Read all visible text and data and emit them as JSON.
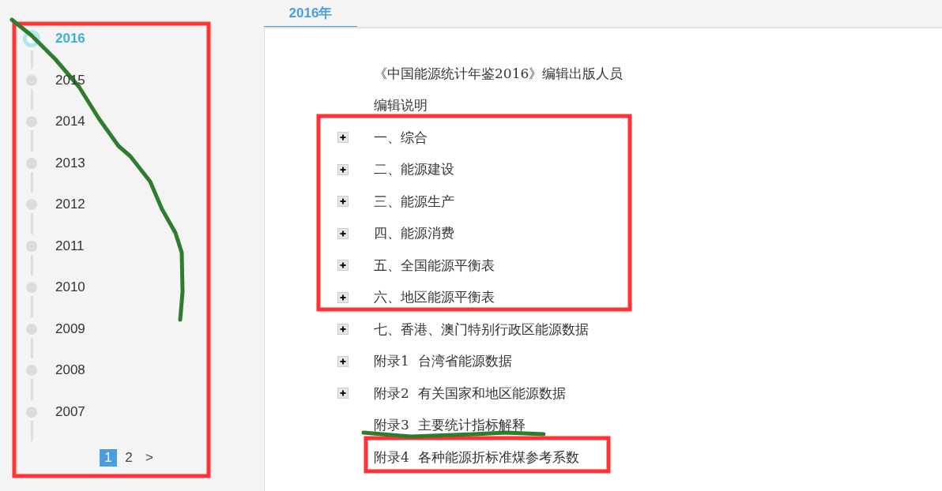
{
  "timeline": {
    "years": [
      {
        "label": "2016",
        "selected": true
      },
      {
        "label": "2015",
        "selected": false
      },
      {
        "label": "2014",
        "selected": false
      },
      {
        "label": "2013",
        "selected": false
      },
      {
        "label": "2012",
        "selected": false
      },
      {
        "label": "2011",
        "selected": false
      },
      {
        "label": "2010",
        "selected": false
      },
      {
        "label": "2009",
        "selected": false
      },
      {
        "label": "2008",
        "selected": false
      },
      {
        "label": "2007",
        "selected": false
      }
    ],
    "pager": [
      {
        "label": "1",
        "selected": true
      },
      {
        "label": "2",
        "selected": false
      },
      {
        "label": ">",
        "selected": false
      }
    ]
  },
  "tabs": [
    {
      "label": "2016年",
      "selected": true
    }
  ],
  "contents": [
    {
      "label": "《中国能源统计年鉴2016》编辑出版人员",
      "expandable": false
    },
    {
      "label": "编辑说明",
      "expandable": false
    },
    {
      "label": "一、综合",
      "expandable": true
    },
    {
      "label": "二、能源建设",
      "expandable": true
    },
    {
      "label": "三、能源生产",
      "expandable": true
    },
    {
      "label": "四、能源消费",
      "expandable": true
    },
    {
      "label": "五、全国能源平衡表",
      "expandable": true
    },
    {
      "label": "六、地区能源平衡表",
      "expandable": true
    },
    {
      "label": "七、香港、澳门特别行政区能源数据",
      "expandable": true
    },
    {
      "label": "附录1  台湾省能源数据",
      "expandable": true
    },
    {
      "label": "附录2  有关国家和地区能源数据",
      "expandable": true
    },
    {
      "label": "附录3  主要统计指标解释",
      "expandable": false
    },
    {
      "label": "附录4  各种能源折标准煤参考系数",
      "expandable": false
    }
  ],
  "annotations": [
    {
      "kind": "box",
      "color": "#ff3333"
    },
    {
      "kind": "box",
      "color": "#ff3333"
    },
    {
      "kind": "box",
      "color": "#ff3333"
    },
    {
      "kind": "stroke",
      "color": "#2e7d2e"
    },
    {
      "kind": "stroke",
      "color": "#2e7d2e"
    }
  ]
}
